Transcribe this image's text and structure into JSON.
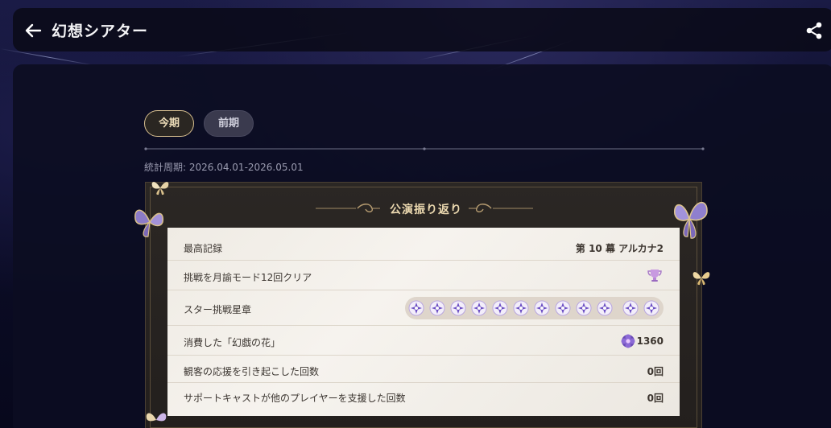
{
  "header": {
    "title": "幻想シアター",
    "back_icon": "arrow-left-icon",
    "share_icon": "share-icon"
  },
  "tabs": [
    {
      "label": "今期",
      "selected": true
    },
    {
      "label": "前期",
      "selected": false
    }
  ],
  "period_label": "統計周期: 2026.04.01-2026.05.01",
  "card": {
    "title": "公演振り返り",
    "rows": [
      {
        "label": "最高記録",
        "value": "第 10 幕 アルカナ2"
      },
      {
        "label": "挑戦を月諭モード12回クリア",
        "value": "",
        "icon": "trophy-icon"
      },
      {
        "label": "スター挑戦星章",
        "value": "",
        "star_count": 12
      },
      {
        "label": "消費した「幻戯の花」",
        "value": "1360",
        "icon": "flower-icon"
      },
      {
        "label": "観客の応援を引き起こした回数",
        "value": "0回"
      },
      {
        "label": "サポートキャストが他のプレイヤーを支援した回数",
        "value": "0回"
      }
    ]
  },
  "colors": {
    "accent_gold": "#d7bf8f",
    "star_purple": "#7b5cc9",
    "card_bg": "#f2eee8"
  }
}
